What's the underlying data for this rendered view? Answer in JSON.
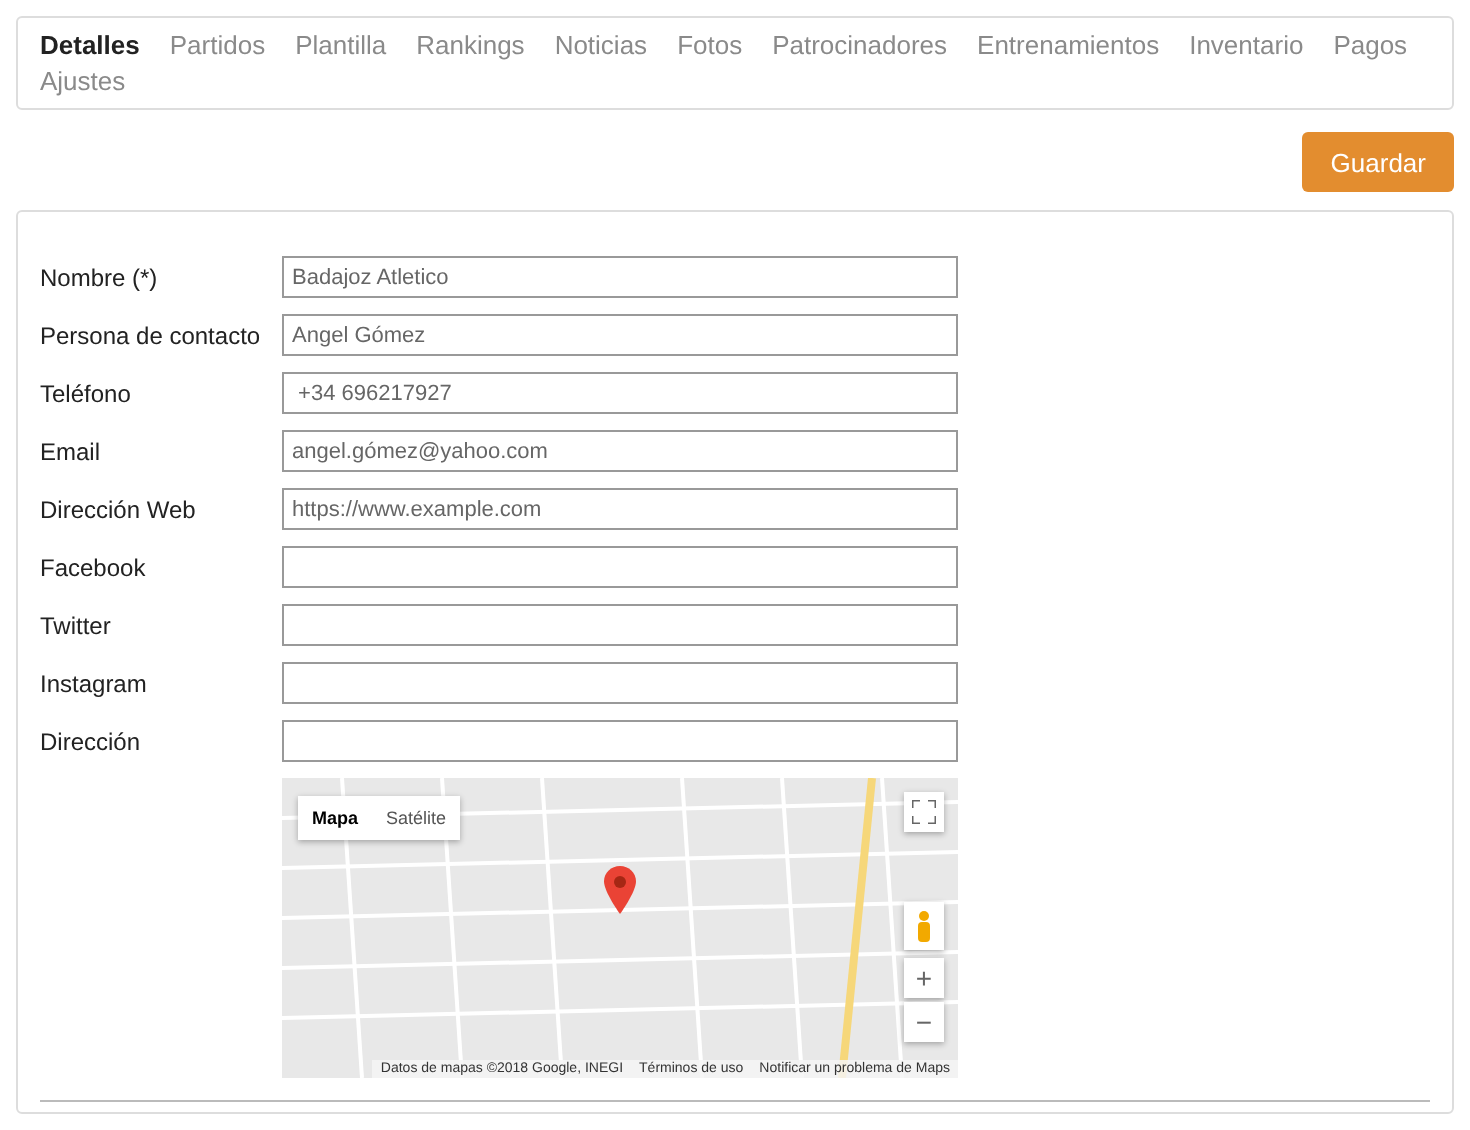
{
  "tabs": [
    {
      "label": "Detalles",
      "selected": true
    },
    {
      "label": "Partidos",
      "selected": false
    },
    {
      "label": "Plantilla",
      "selected": false
    },
    {
      "label": "Rankings",
      "selected": false
    },
    {
      "label": "Noticias",
      "selected": false
    },
    {
      "label": "Fotos",
      "selected": false
    },
    {
      "label": "Patrocinadores",
      "selected": false
    },
    {
      "label": "Entrenamientos",
      "selected": false
    },
    {
      "label": "Inventario",
      "selected": false
    },
    {
      "label": "Pagos",
      "selected": false
    },
    {
      "label": "Ajustes",
      "selected": false
    }
  ],
  "save_button": "Guardar",
  "fields": [
    {
      "label": "Nombre (*)",
      "value": "Badajoz Atletico"
    },
    {
      "label": "Persona de contacto",
      "value": "Angel Gómez"
    },
    {
      "label": "Teléfono",
      "value": " +34 696217927"
    },
    {
      "label": "Email",
      "value": "angel.gómez@yahoo.com"
    },
    {
      "label": "Dirección Web",
      "placeholder": "https://www.example.com"
    },
    {
      "label": "Facebook"
    },
    {
      "label": "Twitter"
    },
    {
      "label": "Instagram"
    },
    {
      "label": "Dirección"
    }
  ],
  "map": {
    "types": [
      {
        "label": "Mapa",
        "selected": true
      },
      {
        "label": "Satélite",
        "selected": false
      }
    ],
    "zoom_in": "+",
    "zoom_out": "−",
    "footer": [
      "Datos de mapas ©2018 Google, INEGI",
      "Términos de uso",
      "Notificar un problema de Maps"
    ]
  }
}
